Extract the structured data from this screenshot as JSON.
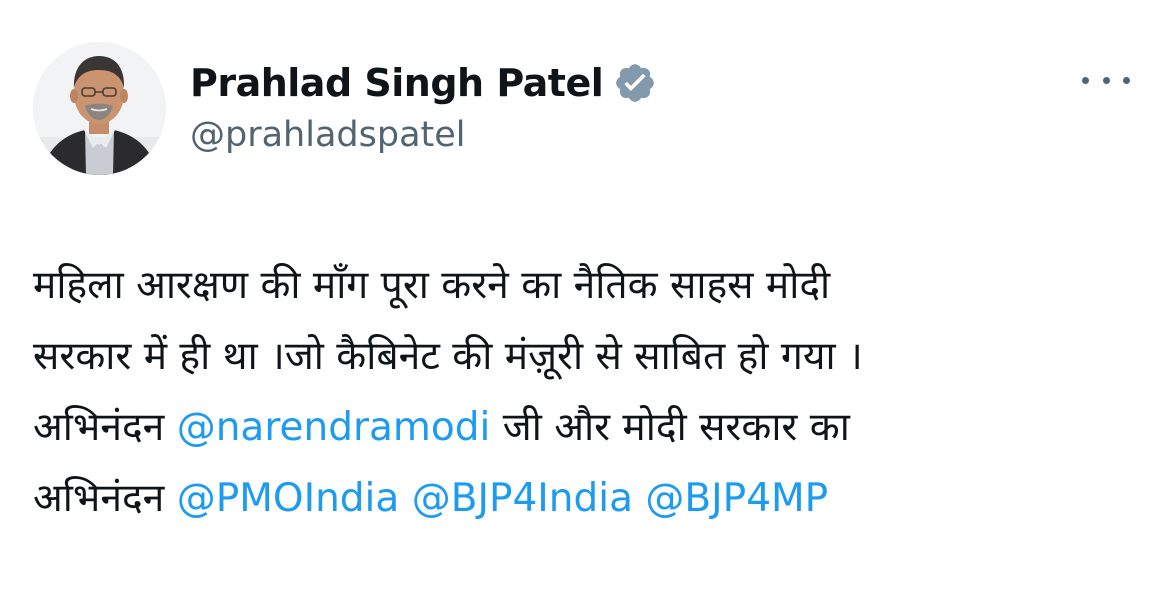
{
  "author": {
    "display_name": "Prahlad Singh Patel",
    "handle": "@prahladspatel",
    "verified": true,
    "verified_badge_color": "#829aab",
    "avatar_icon": "profile-photo"
  },
  "menu": {
    "more_icon": "more-horizontal-icon"
  },
  "tweet": {
    "line1": "महिला आरक्षण की माँग पूरा करने का नैतिक साहस मोदी",
    "line2": "सरकार में ही था ।जो कैबिनेट की मंज़ूरी से साबित हो गया ।",
    "line3_text_a": "अभिनंदन ",
    "line3_mention": "@narendramodi",
    "line3_text_b": " जी और मोदी सरकार का",
    "line4_text_a": "अभिनंदन ",
    "line4_mention_1": "@PMOIndia",
    "line4_space_1": " ",
    "line4_mention_2": "@BJP4India",
    "line4_space_2": " ",
    "line4_mention_3": "@BJP4MP"
  },
  "colors": {
    "text": "#0f1419",
    "secondary": "#536471",
    "link": "#1d9bf0"
  }
}
